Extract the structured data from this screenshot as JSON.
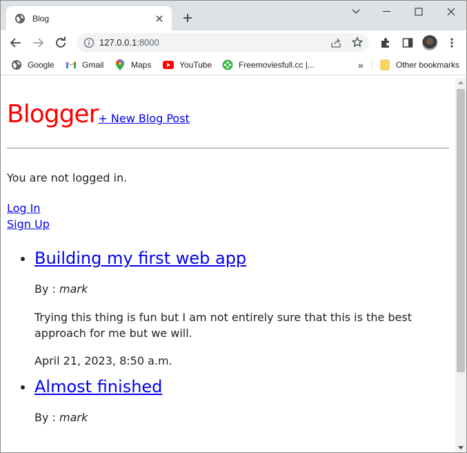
{
  "browser": {
    "tab_title": "Blog",
    "url_host": "127.0.0.1",
    "url_port": ":8000",
    "bookmarks": [
      "Google",
      "Gmail",
      "Maps",
      "YouTube",
      "Freemoviesfull.cc |..."
    ],
    "bookmarks_overflow": "»",
    "other_bookmarks": "Other bookmarks"
  },
  "page": {
    "brand": "Blogger",
    "new_post_link": "+ New Blog Post",
    "login_status": "You are not logged in.",
    "login_link": "Log In",
    "signup_link": "Sign Up"
  },
  "posts": [
    {
      "title": "Building my first web app",
      "by_prefix": "By :",
      "author": "mark",
      "body": "Trying this thing is fun but I am not entirely sure that this is the best approach for me but we will.",
      "date": "April 21, 2023, 8:50 a.m."
    },
    {
      "title": "Almost finished",
      "by_prefix": "By :",
      "author": "mark"
    }
  ],
  "colors": {
    "brand": "#ff0000",
    "link": "#0000ee",
    "tabstrip": "#dee1e6"
  }
}
